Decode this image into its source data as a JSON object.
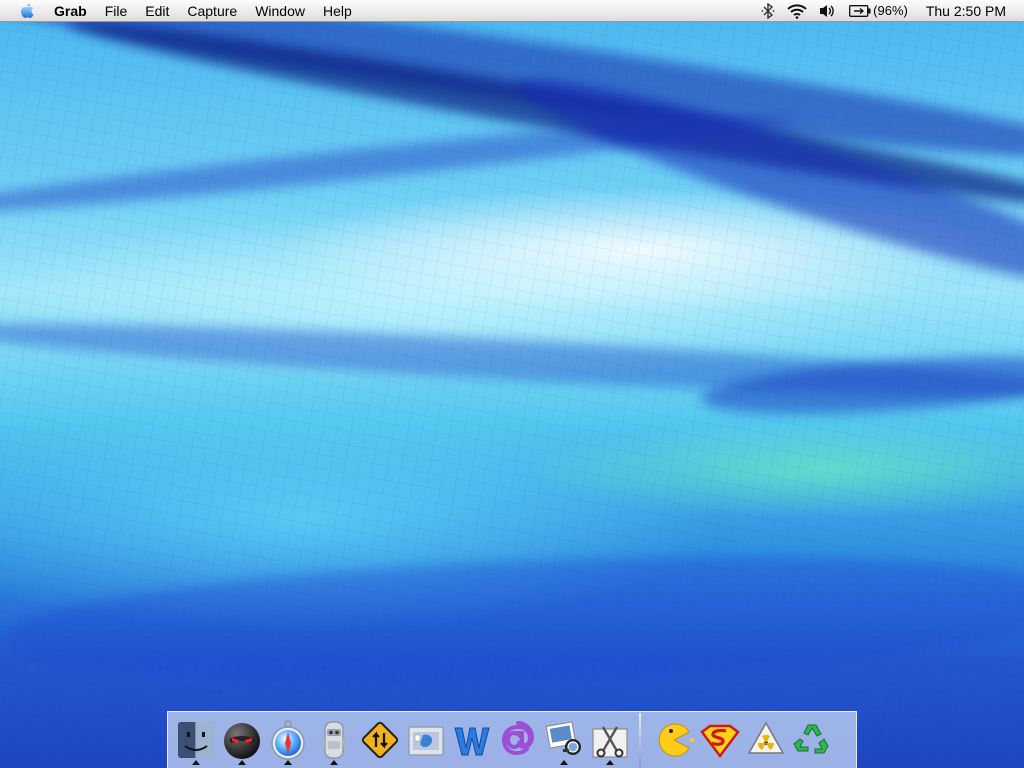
{
  "menubar": {
    "apple_icon": "apple-icon",
    "app_name": "Grab",
    "menus": [
      "File",
      "Edit",
      "Capture",
      "Window",
      "Help"
    ],
    "status": {
      "bluetooth_icon": "bluetooth-icon",
      "wifi_icon": "wifi-icon",
      "volume_icon": "volume-icon",
      "battery_icon": "battery-icon",
      "battery_percent": "(96%)",
      "clock": "Thu 2:50 PM"
    }
  },
  "dock": {
    "apps": [
      {
        "icon": "finder-icon",
        "running": true
      },
      {
        "icon": "red-eyed-orb-icon",
        "running": true
      },
      {
        "icon": "safari-compass-icon",
        "running": true
      },
      {
        "icon": "robot-icon",
        "running": true
      },
      {
        "icon": "transmit-sign-icon",
        "running": false
      },
      {
        "icon": "mail-stamp-icon",
        "running": false
      },
      {
        "icon": "word-icon",
        "running": false
      },
      {
        "icon": "entourage-icon",
        "running": false
      },
      {
        "icon": "iphoto-icon",
        "running": true
      },
      {
        "icon": "grab-scissors-icon",
        "running": true
      }
    ],
    "others": [
      {
        "icon": "pacman-icon"
      },
      {
        "icon": "superman-shield-icon"
      },
      {
        "icon": "radioactive-trash-icon"
      },
      {
        "icon": "recycle-trash-icon"
      }
    ]
  },
  "colors": {
    "desktop_top": "#49b6f0",
    "desktop_bottom": "#1f45c2",
    "menubar": "#ececec",
    "dock": "#cddcf5"
  }
}
